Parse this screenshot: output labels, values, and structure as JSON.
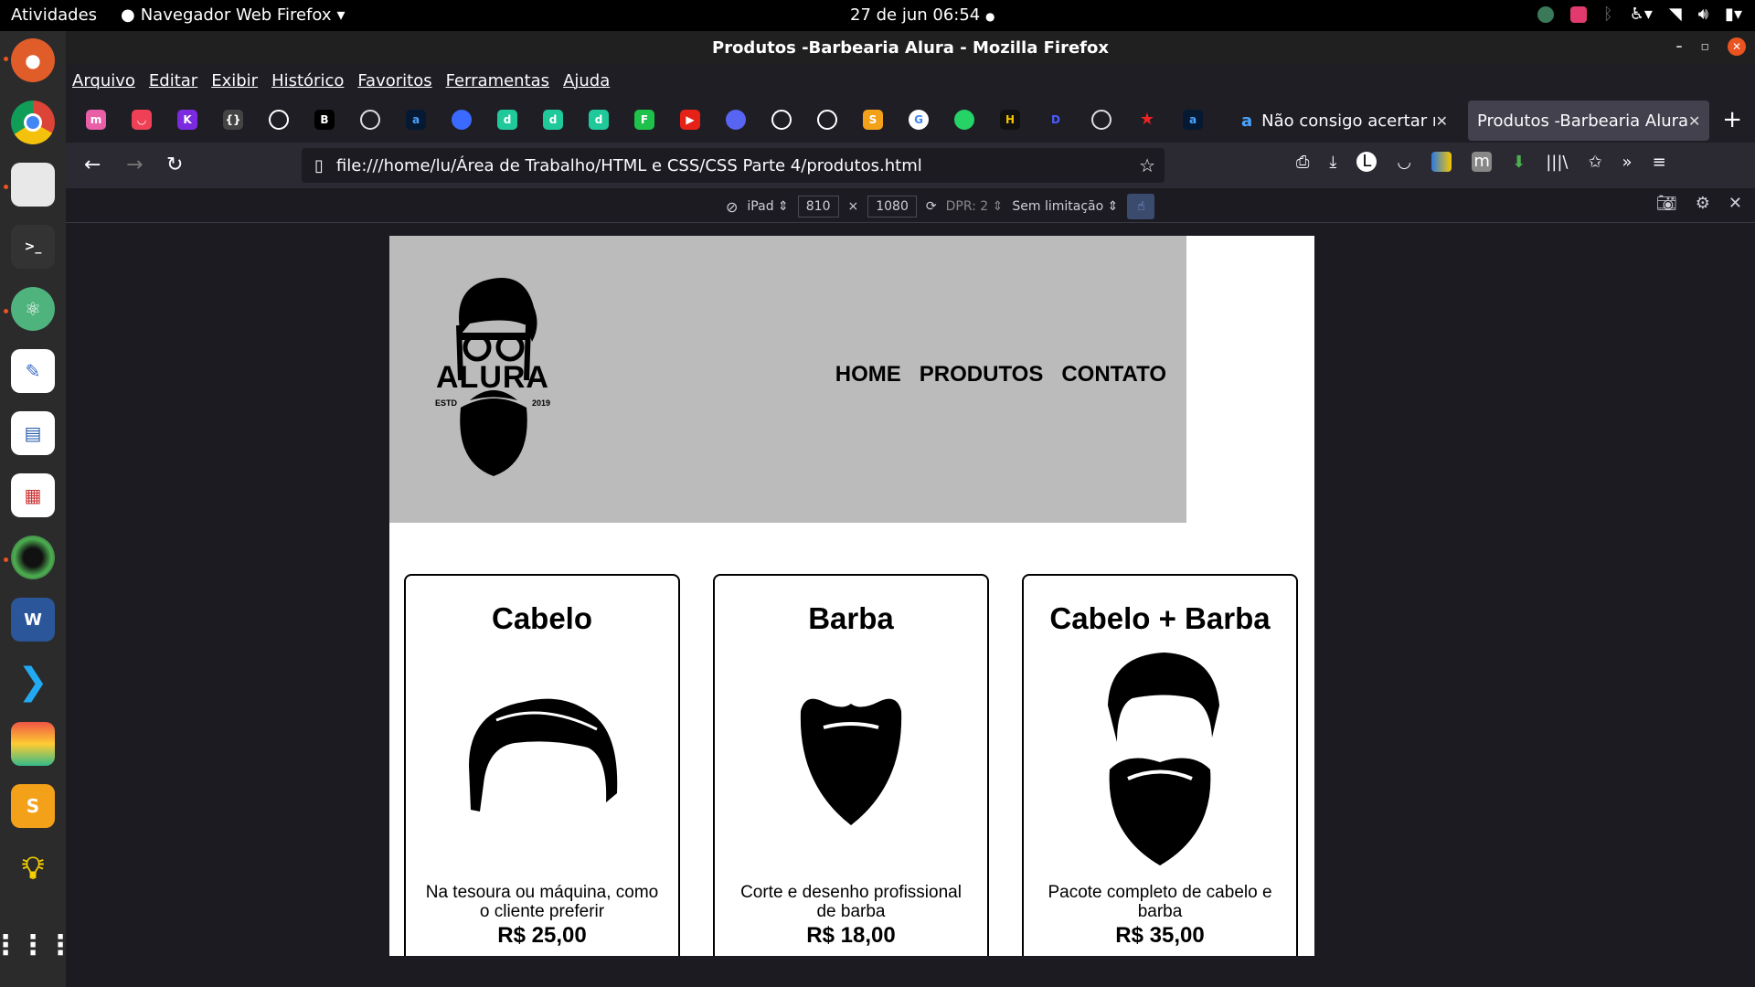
{
  "topbar": {
    "activities": "Atividades",
    "app_name": "Navegador Web Firefox",
    "clock": "27 de jun  06:54"
  },
  "window": {
    "title": "Produtos -Barbearia Alura - Mozilla Firefox"
  },
  "menu": {
    "items": [
      "Arquivo",
      "Editar",
      "Exibir",
      "Histórico",
      "Favoritos",
      "Ferramentas",
      "Ajuda"
    ]
  },
  "tabs": {
    "inactive_label": "Não consigo acertar me",
    "active_label": "Produtos -Barbearia Alura"
  },
  "url": {
    "value": "file:///home/lu/Área de Trabalho/HTML e CSS/CSS Parte 4/produtos.html"
  },
  "rdm": {
    "device": "iPad",
    "width": "810",
    "times": "×",
    "height": "1080",
    "dpr": "DPR: 2",
    "throttle": "Sem limitação"
  },
  "site": {
    "logo_text": "ALURA",
    "logo_small_left": "ESTD",
    "logo_small_right": "2019",
    "nav": [
      "HOME",
      "PRODUTOS",
      "CONTATO"
    ],
    "products": [
      {
        "title": "Cabelo",
        "desc": "Na tesoura ou máquina, como o cliente preferir",
        "price": "R$ 25,00"
      },
      {
        "title": "Barba",
        "desc": "Corte e desenho profissional de barba",
        "price": "R$ 18,00"
      },
      {
        "title": "Cabelo + Barba",
        "desc": "Pacote completo de cabelo e barba",
        "price": "R$ 35,00"
      }
    ]
  },
  "colors": {
    "header_bg": "#bbbbbb",
    "ubuntu_orange": "#e95420",
    "ff_dark": "#1c1b22"
  }
}
